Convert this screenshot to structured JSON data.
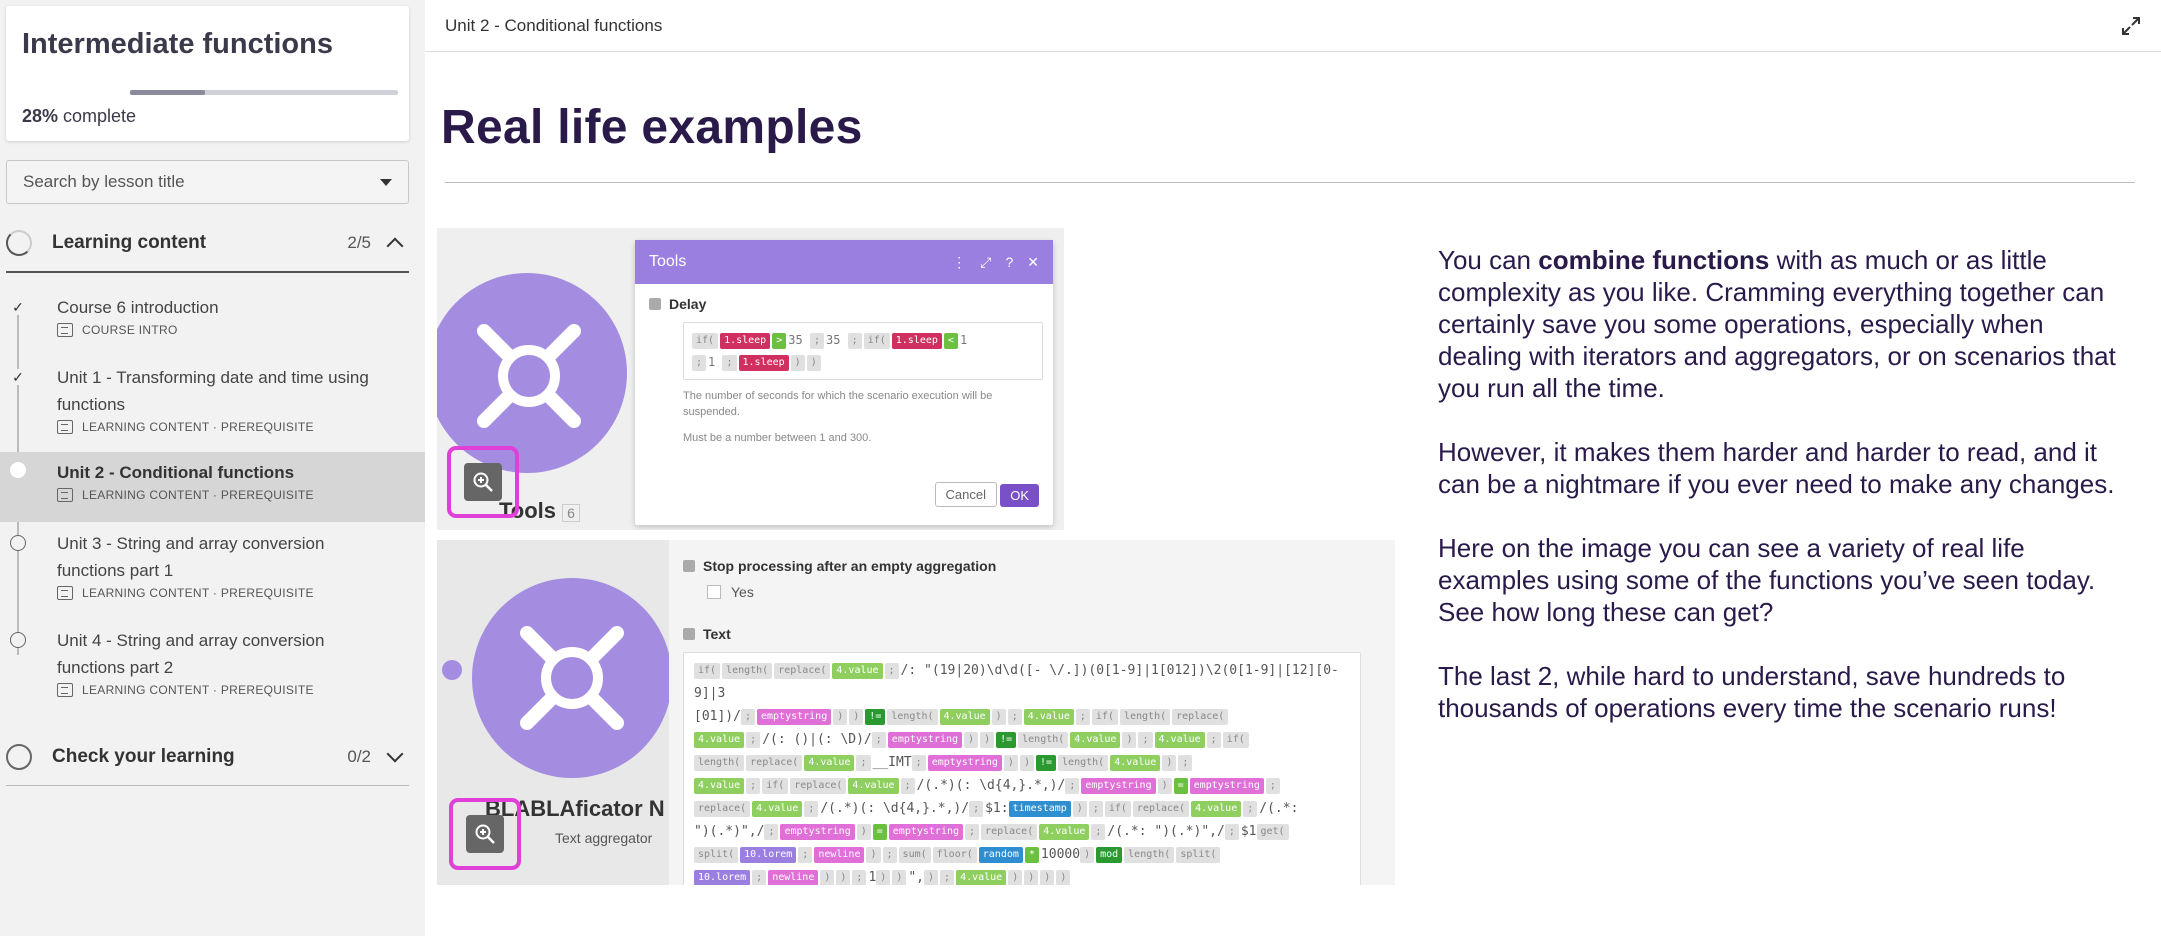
{
  "sidebar": {
    "course_title": "Intermediate functions",
    "progress_percent": "28%",
    "progress_suffix": " complete",
    "progress_value": 0.28,
    "search_placeholder": "Search by lesson title",
    "sections": [
      {
        "title": "Learning content",
        "count": "2/5",
        "expanded": true
      },
      {
        "title": "Check your learning",
        "count": "0/2",
        "expanded": false
      }
    ],
    "lessons": [
      {
        "title": "Course 6 introduction",
        "meta": "COURSE INTRO",
        "status": "done"
      },
      {
        "title": "Unit 1 - Transforming date and time using functions",
        "meta": "LEARNING CONTENT · PREREQUISITE",
        "status": "done"
      },
      {
        "title": "Unit 2 - Conditional functions",
        "meta": "LEARNING CONTENT · PREREQUISITE",
        "status": "current"
      },
      {
        "title": "Unit 3 - String and array conversion functions part 1",
        "meta": "LEARNING CONTENT · PREREQUISITE",
        "status": "todo"
      },
      {
        "title": "Unit 4 - String and array conversion functions part 2",
        "meta": "LEARNING CONTENT · PREREQUISITE",
        "status": "todo"
      }
    ]
  },
  "main": {
    "breadcrumb": "Unit 2 - Conditional functions",
    "title": "Real life examples",
    "paragraphs": [
      {
        "before": "You can ",
        "bold": "combine functions",
        "after": " with as much or as little complexity as you like. Cramming everything together can certainly save you some operations, especially when dealing with iterators and aggregators, or on scenarios that you run all the time."
      },
      {
        "text": "However, it makes them harder and harder to read, and it can be a nightmare if you ever need to make any changes."
      },
      {
        "text": "Here on the image you can see a variety of real life examples using some of the functions you’ve seen today. See how long these can get?"
      },
      {
        "text": "The last 2, while hard to understand, save hundreds to thousands of operations every time the scenario runs!"
      }
    ]
  },
  "image1": {
    "dialog_title": "Tools",
    "section": "Delay",
    "hint1": "The number of seconds for which the scenario execution will be suspended.",
    "hint2": "Must be a number between 1 and 300.",
    "cancel": "Cancel",
    "ok": "OK",
    "module_label": "Tools",
    "module_count": "6"
  },
  "image2": {
    "checkbox_label": "Stop processing after an empty aggregation",
    "yes": "Yes",
    "text_label": "Text",
    "module_label": "BLABLAficator N",
    "module_sub": "Text aggregator"
  },
  "colors": {
    "accent_purple": "#9a7fe0",
    "zoom_highlight": "#e040d8",
    "title_dark": "#2a1a4a"
  }
}
